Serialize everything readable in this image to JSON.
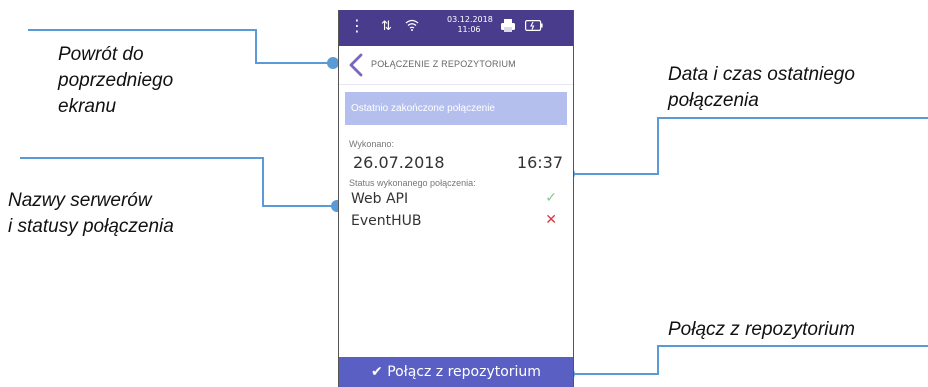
{
  "annotations": {
    "back": [
      "Powrót do",
      "poprzedniego",
      "ekranu"
    ],
    "servers": [
      "Nazwy serwerów",
      "i statusy połączenia"
    ],
    "datetime": [
      "Data i czas ostatniego",
      "połączenia"
    ],
    "connect": "Połącz z repozytorium"
  },
  "statusbar": {
    "date": "03.12.2018",
    "time": "11:06",
    "icons": [
      "menu-dots-icon",
      "transfer-icon",
      "wifi-icon",
      "printer-icon",
      "battery-icon"
    ]
  },
  "screen": {
    "title": "POŁĄCZENIE Z REPOZYTORIUM",
    "section_label": "Ostatnio zakończone połączenie",
    "executed_label": "Wykonano:",
    "executed_date": "26.07.2018",
    "executed_time": "16:37",
    "status_label": "Status wykonanego połączenia:",
    "servers": [
      {
        "name": "Web API",
        "status": "ok",
        "glyph": "✓"
      },
      {
        "name": "EventHUB",
        "status": "error",
        "glyph": "✕"
      }
    ],
    "connect_button": "✔ Połącz z repozytorium"
  },
  "colors": {
    "statusbar": "#4a3c8c",
    "section": "#b4bfee",
    "button": "#5a5fc4",
    "callout_line": "#5b9bd5",
    "ok": "#7ecb8e",
    "error": "#d9363e"
  }
}
